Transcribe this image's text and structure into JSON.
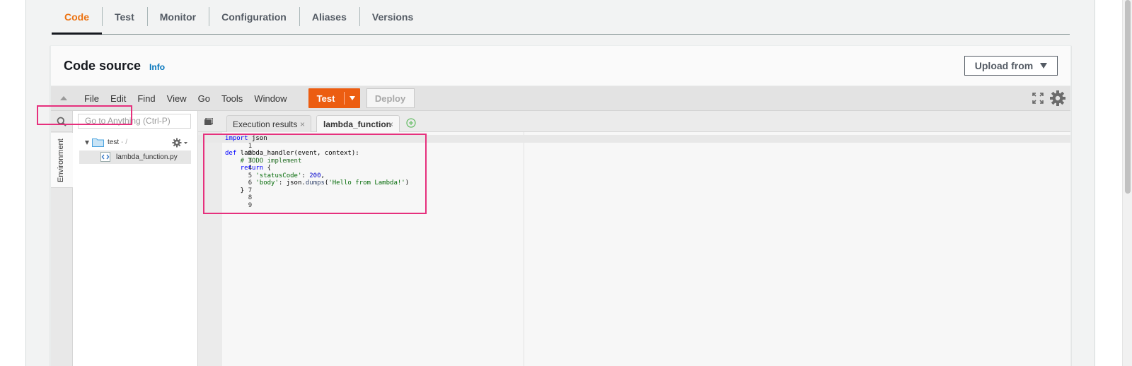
{
  "tabs": [
    {
      "label": "Code",
      "active": true
    },
    {
      "label": "Test",
      "active": false
    },
    {
      "label": "Monitor",
      "active": false
    },
    {
      "label": "Configuration",
      "active": false
    },
    {
      "label": "Aliases",
      "active": false
    },
    {
      "label": "Versions",
      "active": false
    }
  ],
  "code_source": {
    "title": "Code source",
    "info_label": "Info",
    "upload_label": "Upload from"
  },
  "ide": {
    "menu": [
      "File",
      "Edit",
      "Find",
      "View",
      "Go",
      "Tools",
      "Window"
    ],
    "test_label": "Test",
    "deploy_label": "Deploy",
    "environment_label": "Environment",
    "goto_placeholder": "Go to Anything (Ctrl-P)",
    "tree": {
      "root_name": "test",
      "root_path": "- /",
      "file_name": "lambda_function.py"
    },
    "editor_tabs": [
      "Execution results",
      "lambda_function"
    ],
    "close_glyph": "×",
    "lines": [
      {
        "n": "1",
        "text": "import json"
      },
      {
        "n": "2",
        "text": ""
      },
      {
        "n": "3",
        "text": "def lambda_handler(event, context):"
      },
      {
        "n": "4",
        "text": "    # TODO implement"
      },
      {
        "n": "5",
        "text": "    return {"
      },
      {
        "n": "6",
        "text": "        'statusCode': 200,"
      },
      {
        "n": "7",
        "text": "        'body': json.dumps('Hello from Lambda!')"
      },
      {
        "n": "8",
        "text": "    }"
      },
      {
        "n": "9",
        "text": ""
      }
    ]
  },
  "colors": {
    "accent": "#ec7211",
    "test_button": "#ec5d11",
    "link": "#0073bb",
    "highlight": "#e6307d"
  }
}
